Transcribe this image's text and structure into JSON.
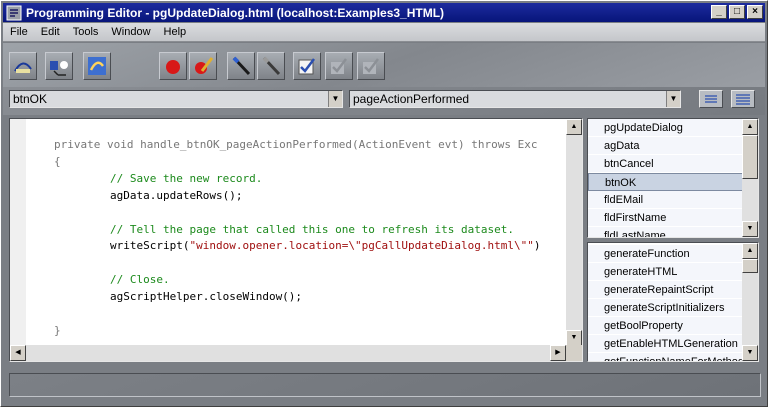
{
  "window": {
    "title": "Programming Editor - pgUpdateDialog.html  (localhost:Examples3_HTML)",
    "controls": {
      "minimize": "_",
      "maximize": "□",
      "close": "×"
    }
  },
  "menu": [
    "File",
    "Edit",
    "Tools",
    "Window",
    "Help"
  ],
  "toolbar": {
    "icons": [
      "step-icon",
      "network-icon",
      "refresh-icon",
      "breakpoint-icon",
      "edit-breakpoint-icon",
      "wand-icon",
      "wand-gray-icon",
      "checklist-icon",
      "check-disabled-icon",
      "check-disabled-2-icon"
    ]
  },
  "selectors": {
    "object": "btnOK",
    "event": "pageActionPerformed"
  },
  "code": {
    "line1": "private void handle_btnOK_pageActionPerformed(ActionEvent evt) throws Exc",
    "line2": "{",
    "line3": "// Save the new record.",
    "line4": "agData.updateRows();",
    "line5": "",
    "line6": "// Tell the page that called this one to refresh its dataset.",
    "line7_pre": "writeScript(",
    "line7_str": "\"window.opener.location=\\\"pgCallUpdateDialog.html\\\"\"",
    "line7_post": ")",
    "line8": "",
    "line9": "// Close.",
    "line10": "agScriptHelper.closeWindow();",
    "line11": "",
    "line12": "}"
  },
  "objects_list": {
    "items": [
      "pgUpdateDialog",
      "agData",
      "btnCancel",
      "btnOK",
      "fldEMail",
      "fldFirstName",
      "fldLastName"
    ],
    "selected": "btnOK"
  },
  "methods_list": {
    "items": [
      "generateFunction",
      "generateHTML",
      "generateRepaintScript",
      "generateScriptInitializers",
      "getBoolProperty",
      "getEnableHTMLGeneration",
      "getFunctionNameForMethod"
    ]
  }
}
